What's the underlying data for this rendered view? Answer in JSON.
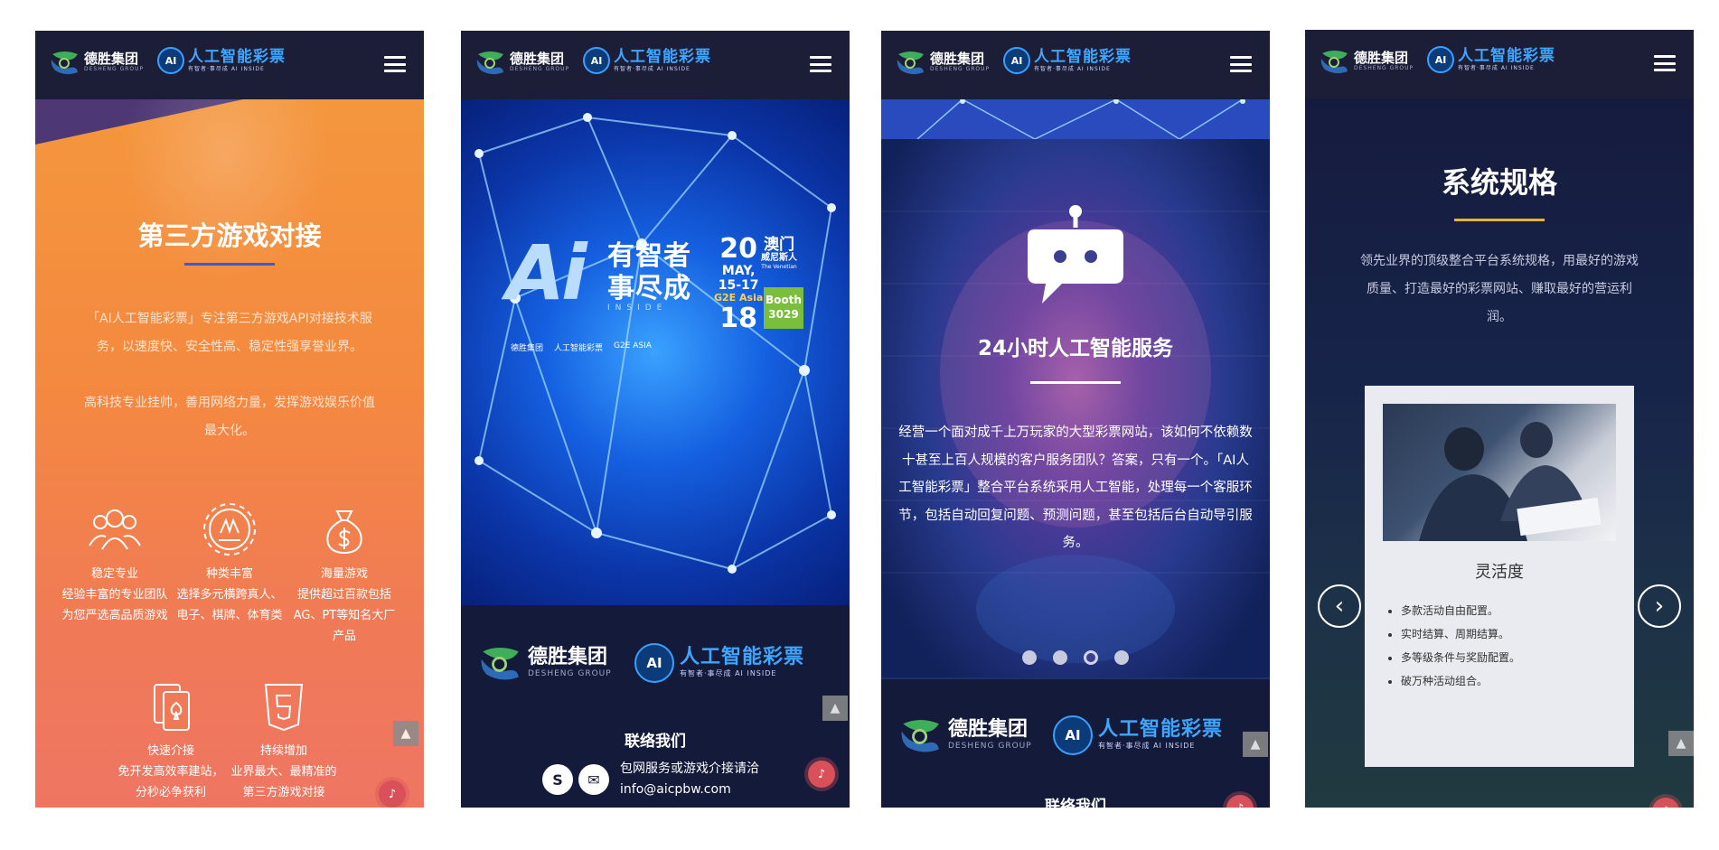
{
  "brand": {
    "group_name": "德胜集团",
    "group_sub": "DESHENG GROUP",
    "ai_name": "人工智能彩票",
    "ai_slogan": "有智者·事尽成 AI INSIDE",
    "ai_badge": "AI"
  },
  "panel1": {
    "title": "第三方游戏对接",
    "paragraph1": "「AI人工智能彩票」专注第三方游戏API对接技术服务，以速度快、安全性高、稳定性强享誉业界。",
    "paragraph2": "高科技专业挂帅，善用网络力量，发挥游戏娱乐价值最大化。",
    "features": [
      {
        "icon": "users-icon",
        "title": "稳定专业",
        "desc": "经验丰富的专业团队为您严选高品质游戏"
      },
      {
        "icon": "gear-icon",
        "title": "种类丰富",
        "desc": "选择多元横跨真人、电子、棋牌、体育类"
      },
      {
        "icon": "money-bag-icon",
        "title": "海量游戏",
        "desc": "提供超过百款包括AG、PT等知名大厂产品"
      },
      {
        "icon": "cards-icon",
        "title": "快速介接",
        "desc": "免开发高效率建站，分秒必争获利"
      },
      {
        "icon": "html5-icon",
        "title": "持续增加",
        "desc": "业界最大、最精准的第三方游戏对接"
      }
    ],
    "accent": "#3b5bd6"
  },
  "panel2": {
    "poster_ai": "Ai",
    "poster_cn_line1": "有智者",
    "poster_cn_line2": "事尽成",
    "poster_inside": "INSIDE",
    "date_day1": "20",
    "date_month": "MAY,",
    "date_range": "15-17",
    "date_day2": "18",
    "event_tag": "G2E Asia",
    "city": "澳门",
    "venue_cn": "威尼斯人",
    "venue_en": "The Venetian",
    "booth_label": "Booth",
    "booth_number": "3029",
    "expo_mark": "G2E ASIA",
    "contact_title": "联络我们",
    "contact_line1": "包网服务或游戏介接请洽",
    "contact_line2": "info@aicpbw.com",
    "contact_icons": [
      "skype-icon",
      "mail-icon"
    ]
  },
  "panel3": {
    "title": "24小时人工智能服务",
    "text": "经营一个面对成千上万玩家的大型彩票网站，该如何不依赖数十甚至上百人规模的客户服务团队？答案，只有一个。「AI人工智能彩票」整合平台系统采用人工智能，处理每一个客服环节，包括自动回复问题、预测问题，甚至包括后台自动导引服务。",
    "dots": 4,
    "active_dot": 2,
    "contact_title": "联络我们"
  },
  "panel4": {
    "title": "系统规格",
    "intro": "领先业界的顶级整合平台系统规格，用最好的游戏质量、打造最好的彩票网站、赚取最好的营运利润。",
    "card_title": "灵活度",
    "card_items": [
      "多款活动自由配置。",
      "实时结算、周期结算。",
      "多等级条件与奖励配置。",
      "破万种活动组合。"
    ],
    "accent": "#e4b72b"
  },
  "ui": {
    "to_top": "▲",
    "prev": "‹",
    "next": "›"
  }
}
